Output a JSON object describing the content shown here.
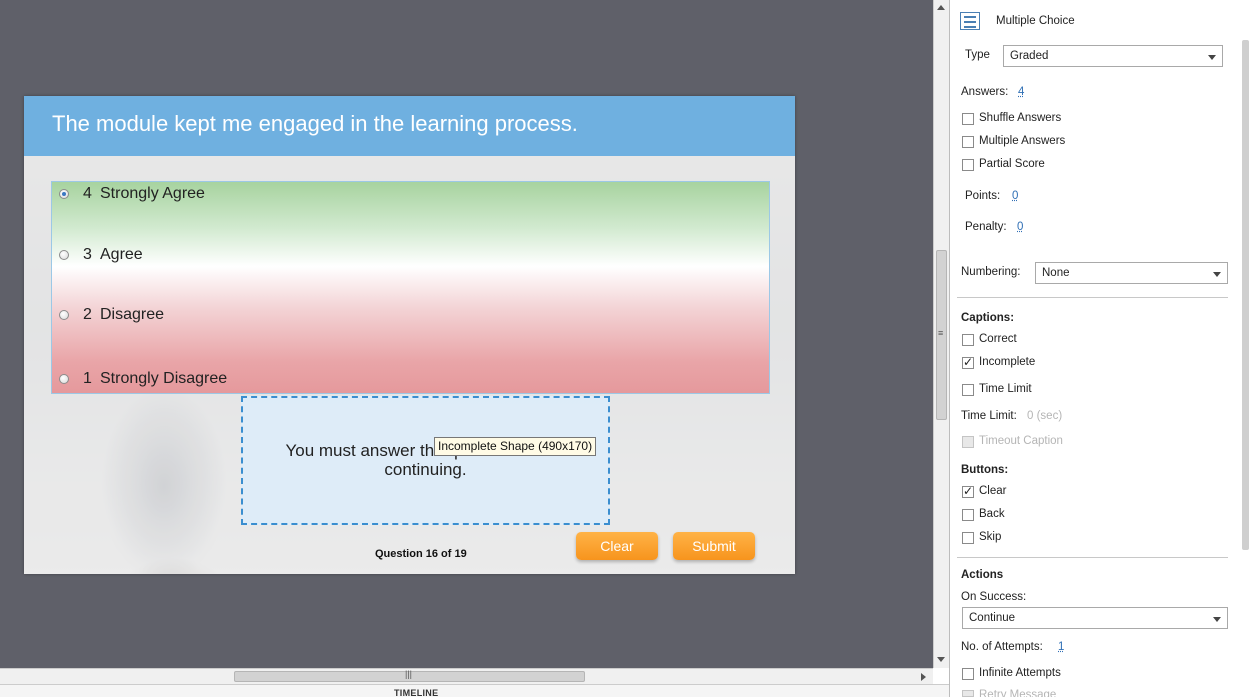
{
  "slide": {
    "title": "The module kept me engaged in the learning process.",
    "answers": [
      {
        "num": "4",
        "label": "Strongly Agree",
        "selected": true
      },
      {
        "num": "3",
        "label": "Agree",
        "selected": false
      },
      {
        "num": "2",
        "label": "Disagree",
        "selected": false
      },
      {
        "num": "1",
        "label": "Strongly Disagree",
        "selected": false
      }
    ],
    "incomplete_text_line1": "You must answer the question before",
    "incomplete_text_line2": "continuing.",
    "tooltip": "Incomplete Shape (490x170)",
    "progress": "Question 16 of 19",
    "clear_label": "Clear",
    "submit_label": "Submit"
  },
  "timeline": {
    "label": "TIMELINE"
  },
  "props": {
    "header": "Multiple Choice",
    "type_label": "Type",
    "type_value": "Graded",
    "answers_label": "Answers:",
    "answers_value": "4",
    "shuffle": "Shuffle Answers",
    "multiple": "Multiple Answers",
    "partial": "Partial Score",
    "points_label": "Points:",
    "points_value": "0",
    "penalty_label": "Penalty:",
    "penalty_value": "0",
    "numbering_label": "Numbering:",
    "numbering_value": "None",
    "captions_head": "Captions:",
    "cap_correct": "Correct",
    "cap_incomplete": "Incomplete",
    "cap_timelimit": "Time Limit",
    "timelimit_label": "Time Limit:",
    "timelimit_value": "0 (sec)",
    "timeout_caption": "Timeout Caption",
    "buttons_head": "Buttons:",
    "btn_clear": "Clear",
    "btn_back": "Back",
    "btn_skip": "Skip",
    "actions_head": "Actions",
    "on_success_label": "On Success:",
    "on_success_value": "Continue",
    "attempts_label": "No. of Attempts:",
    "attempts_value": "1",
    "infinite": "Infinite Attempts",
    "retry": "Retry Message"
  },
  "colors": {
    "stage_bg": "#5f6069",
    "title_bar": "#6fb0e0",
    "button_orange": "#f7941d",
    "incomplete_border": "#3a8ed0"
  }
}
